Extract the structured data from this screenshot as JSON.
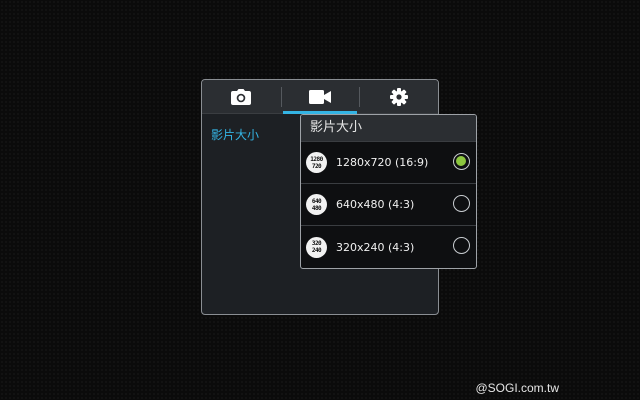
{
  "tabs": [
    {
      "icon": "camera-icon",
      "active": false
    },
    {
      "icon": "video-camera-icon",
      "active": true
    },
    {
      "icon": "gear-icon",
      "active": false
    }
  ],
  "panel": {
    "item_label": "影片大小"
  },
  "dropdown": {
    "title": "影片大小",
    "options": [
      {
        "icon_top": "1280",
        "icon_bottom": "720",
        "label": "1280x720 (16:9)",
        "selected": true
      },
      {
        "icon_top": "640",
        "icon_bottom": "480",
        "label": "640x480 (4:3)",
        "selected": false
      },
      {
        "icon_top": "320",
        "icon_bottom": "240",
        "label": "320x240 (4:3)",
        "selected": false
      }
    ]
  },
  "colors": {
    "accent": "#34b4e4",
    "radio_selected": "#8cc63f"
  },
  "watermark": "@SOGI.com.tw"
}
